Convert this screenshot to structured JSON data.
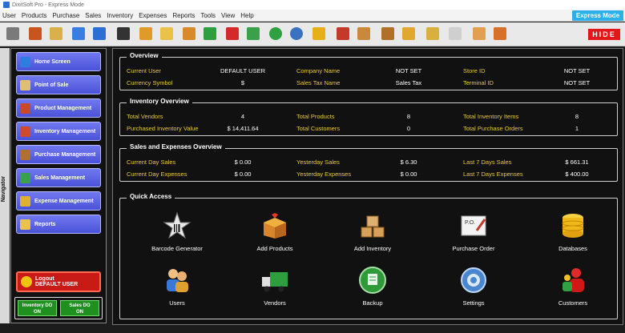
{
  "title_bar": {
    "text": "DixitSoft Pro - Express Mode"
  },
  "menu": {
    "items": [
      "User",
      "Products",
      "Purchase",
      "Sales",
      "Inventory",
      "Expenses",
      "Reports",
      "Tools",
      "View",
      "Help"
    ],
    "express_mode": "Express Mode"
  },
  "toolbar": {
    "hide_label": "HIDE"
  },
  "navigator": {
    "tab_label": "Navigator",
    "buttons": [
      "Home Screen",
      "Point of Sale",
      "Product Management",
      "Inventory Management",
      "Purchase Management",
      "Sales Management",
      "Expense Management",
      "Reports"
    ],
    "logout": {
      "line1": "Logout",
      "line2": "DEFAULT USER"
    },
    "inventory_do": {
      "line1": "Inventory DO",
      "line2": "ON"
    },
    "sales_do": {
      "line1": "Sales DO",
      "line2": "ON"
    }
  },
  "overview": {
    "title": "Overview",
    "current_user_label": "Current User",
    "current_user": "DEFAULT USER",
    "currency_symbol_label": "Currency Symbol",
    "currency_symbol": "$",
    "company_name_label": "Company Name",
    "company_name": "NOT SET",
    "sales_tax_name_label": "Sales Tax Name",
    "sales_tax_name": "Sales Tax",
    "store_id_label": "Store ID",
    "store_id": "NOT SET",
    "terminal_id_label": "Terminal ID",
    "terminal_id": "NOT SET"
  },
  "inventory_overview": {
    "title": "Inventory Overview",
    "total_vendors_label": "Total Vendors",
    "total_vendors": "4",
    "purchased_value_label": "Purchased Inventory Value",
    "purchased_value": "$ 14,411.64",
    "total_products_label": "Total Products",
    "total_products": "8",
    "total_customers_label": "Total Customers",
    "total_customers": "0",
    "total_items_label": "Total Inventory Items",
    "total_items": "8",
    "total_orders_label": "Total Purchase Orders",
    "total_orders": "1"
  },
  "sales_expenses": {
    "title": "Sales and Expenses Overview",
    "current_day_sales_label": "Current Day Sales",
    "current_day_sales": "$ 0.00",
    "current_day_expenses_label": "Current Day Expenses",
    "current_day_expenses": "$ 0.00",
    "yesterday_sales_label": "Yesterday Sales",
    "yesterday_sales": "$ 6.30",
    "yesterday_expenses_label": "Yesterday Expenses",
    "yesterday_expenses": "$ 0.00",
    "last7_sales_label": "Last 7 Days Sales",
    "last7_sales": "$ 661.31",
    "last7_expenses_label": "Last 7 Days Expenses",
    "last7_expenses": "$ 400.00"
  },
  "quick_access": {
    "title": "Quick Access",
    "items": [
      "Barcode Generator",
      "Add Products",
      "Add Inventory",
      "Purchase Order",
      "Databases",
      "Users",
      "Vendors",
      "Backup",
      "Settings",
      "Customers"
    ]
  },
  "colors": {
    "label": "#e8c83c",
    "nav_button": "#5a62e6",
    "express": "#2bb0ea",
    "hide": "#e4161b",
    "toggle": "#1f8f20"
  }
}
